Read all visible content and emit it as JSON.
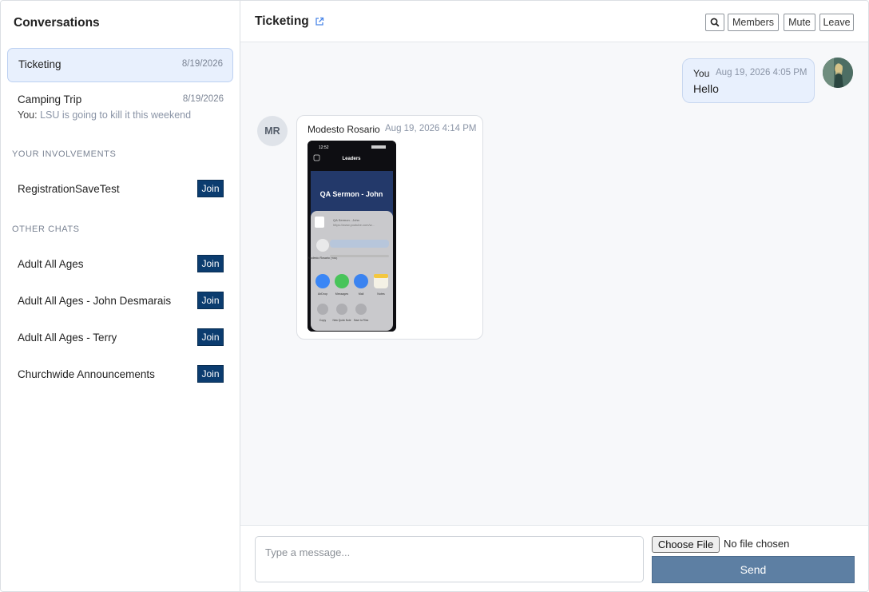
{
  "sidebar": {
    "title": "Conversations",
    "conversations": [
      {
        "name": "Ticketing",
        "date": "8/19/2026",
        "active": true
      },
      {
        "name": "Camping Trip",
        "date": "8/19/2026",
        "preview_sender": "You:",
        "preview_text": "LSU is going to kill it this weekend"
      }
    ],
    "involvements_label": "YOUR INVOLVEMENTS",
    "involvements": [
      {
        "name": "RegistrationSaveTest",
        "action": "Join"
      }
    ],
    "other_label": "OTHER CHATS",
    "other_chats": [
      {
        "name": "Adult All Ages",
        "action": "Join"
      },
      {
        "name": "Adult All Ages - John Desmarais",
        "action": "Join"
      },
      {
        "name": "Adult All Ages - Terry",
        "action": "Join"
      },
      {
        "name": "Churchwide Announcements",
        "action": "Join"
      }
    ]
  },
  "header": {
    "title": "Ticketing",
    "external_icon": "external-link-icon",
    "search_icon": "search-icon",
    "members_label": "Members",
    "mute_label": "Mute",
    "leave_label": "Leave"
  },
  "messages": [
    {
      "sender": "You",
      "timestamp": "Aug 19, 2026 4:05 PM",
      "text": "Hello"
    },
    {
      "sender": "Modesto Rosario",
      "initials": "MR",
      "timestamp": "Aug 19, 2026 4:14 PM",
      "attachment": {
        "status_time": "12:52",
        "screen_title": "Leaders",
        "banner_text": "QA Sermon - John",
        "share_title": "QA Sermon - John",
        "share_url": "https://www.youtube.com/w...",
        "contact_name": "Modesto Rosario (You)",
        "apps": [
          "AirDrop",
          "Messages",
          "Mail",
          "Notes"
        ],
        "actions": [
          "Copy",
          "New Quick Note",
          "Save to Files"
        ]
      }
    }
  ],
  "composer": {
    "placeholder": "Type a message...",
    "file_button": "Choose File",
    "file_status": "No file chosen",
    "send_label": "Send"
  },
  "colors": {
    "join_button": "#0b3c6f",
    "send_button": "#5d7fa3",
    "active_conversation": "#e8f0fd",
    "accent_link": "#4a86e8"
  }
}
